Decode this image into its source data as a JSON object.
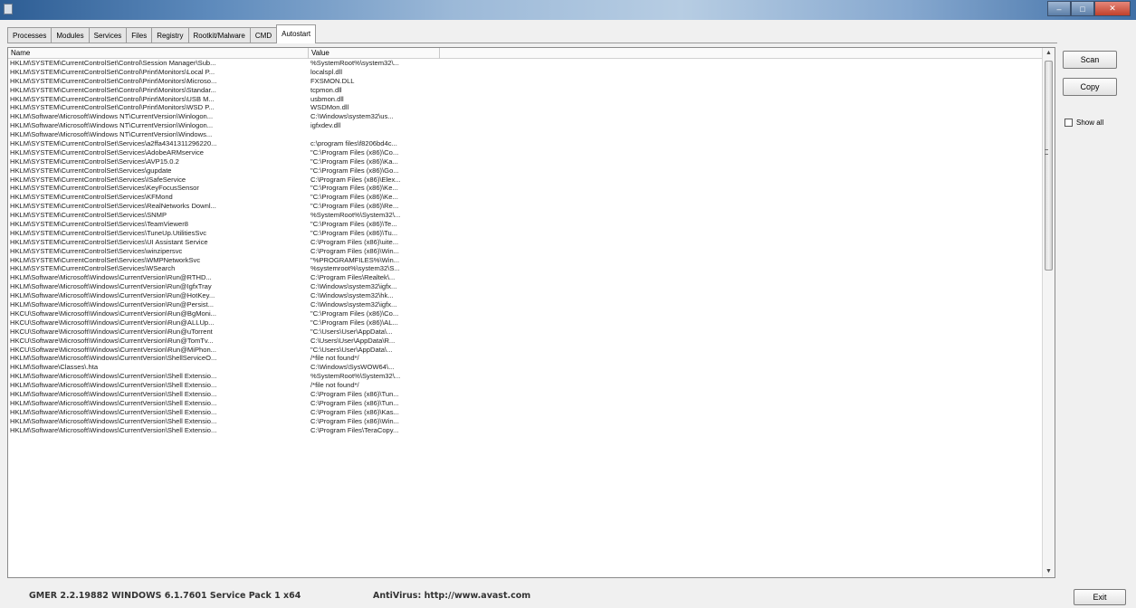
{
  "window": {
    "controls": {
      "minimize": "–",
      "maximize": "□",
      "close": "✕"
    }
  },
  "tabs": [
    "Processes",
    "Modules",
    "Services",
    "Files",
    "Registry",
    "Rootkit/Malware",
    "CMD",
    "Autostart"
  ],
  "active_tab": "Autostart",
  "table": {
    "columns": [
      "Name",
      "Value"
    ],
    "rows": [
      [
        "HKLM\\SYSTEM\\CurrentControlSet\\Control\\Session Manager\\Sub...",
        "%SystemRoot%\\system32\\..."
      ],
      [
        "HKLM\\SYSTEM\\CurrentControlSet\\Control\\Print\\Monitors\\Local P...",
        "localspl.dll"
      ],
      [
        "HKLM\\SYSTEM\\CurrentControlSet\\Control\\Print\\Monitors\\Microso...",
        "FXSMON.DLL"
      ],
      [
        "HKLM\\SYSTEM\\CurrentControlSet\\Control\\Print\\Monitors\\Standar...",
        "tcpmon.dll"
      ],
      [
        "HKLM\\SYSTEM\\CurrentControlSet\\Control\\Print\\Monitors\\USB M...",
        "usbmon.dll"
      ],
      [
        "HKLM\\SYSTEM\\CurrentControlSet\\Control\\Print\\Monitors\\WSD P...",
        "WSDMon.dll"
      ],
      [
        "HKLM\\Software\\Microsoft\\Windows NT\\CurrentVersion\\Winlogon...",
        "C:\\Windows\\system32\\us..."
      ],
      [
        "HKLM\\Software\\Microsoft\\Windows NT\\CurrentVersion\\Winlogon...",
        "igfxdev.dll"
      ],
      [
        "HKLM\\Software\\Microsoft\\Windows NT\\CurrentVersion\\Windows...",
        ""
      ],
      [
        "HKLM\\SYSTEM\\CurrentControlSet\\Services\\a2ffa4341311296220...",
        "c:\\program files\\f8206bd4c..."
      ],
      [
        "HKLM\\SYSTEM\\CurrentControlSet\\Services\\AdobeARMservice",
        "\"C:\\Program Files (x86)\\Co..."
      ],
      [
        "HKLM\\SYSTEM\\CurrentControlSet\\Services\\AVP15.0.2",
        "\"C:\\Program Files (x86)\\Ka..."
      ],
      [
        "HKLM\\SYSTEM\\CurrentControlSet\\Services\\gupdate",
        "\"C:\\Program Files (x86)\\Go..."
      ],
      [
        "HKLM\\SYSTEM\\CurrentControlSet\\Services\\ISafeService",
        "C:\\Program Files (x86)\\Elex..."
      ],
      [
        "HKLM\\SYSTEM\\CurrentControlSet\\Services\\KeyFocusSensor",
        "\"C:\\Program Files (x86)\\Ke..."
      ],
      [
        "HKLM\\SYSTEM\\CurrentControlSet\\Services\\KFMond",
        "\"C:\\Program Files (x86)\\Ke..."
      ],
      [
        "HKLM\\SYSTEM\\CurrentControlSet\\Services\\RealNetworks Downl...",
        "\"C:\\Program Files (x86)\\Re..."
      ],
      [
        "HKLM\\SYSTEM\\CurrentControlSet\\Services\\SNMP",
        "%SystemRoot%\\System32\\..."
      ],
      [
        "HKLM\\SYSTEM\\CurrentControlSet\\Services\\TeamViewer8",
        "\"C:\\Program Files (x86)\\Te..."
      ],
      [
        "HKLM\\SYSTEM\\CurrentControlSet\\Services\\TuneUp.UtilitiesSvc",
        "\"C:\\Program Files (x86)\\Tu..."
      ],
      [
        "HKLM\\SYSTEM\\CurrentControlSet\\Services\\UI Assistant Service",
        "C:\\Program Files (x86)\\uite..."
      ],
      [
        "HKLM\\SYSTEM\\CurrentControlSet\\Services\\winzipersvc",
        "C:\\Program Files (x86)\\Win..."
      ],
      [
        "HKLM\\SYSTEM\\CurrentControlSet\\Services\\WMPNetworkSvc",
        "\"%PROGRAMFILES%\\Win..."
      ],
      [
        "HKLM\\SYSTEM\\CurrentControlSet\\Services\\WSearch",
        "%systemroot%\\system32\\S..."
      ],
      [
        "HKLM\\Software\\Microsoft\\Windows\\CurrentVersion\\Run@RTHD...",
        "C:\\Program Files\\Realtek\\..."
      ],
      [
        "HKLM\\Software\\Microsoft\\Windows\\CurrentVersion\\Run@IgfxTray",
        "C:\\Windows\\system32\\igfx..."
      ],
      [
        "HKLM\\Software\\Microsoft\\Windows\\CurrentVersion\\Run@HotKey...",
        "C:\\Windows\\system32\\hk..."
      ],
      [
        "HKLM\\Software\\Microsoft\\Windows\\CurrentVersion\\Run@Persist...",
        "C:\\Windows\\system32\\igfx..."
      ],
      [
        "HKCU\\Software\\Microsoft\\Windows\\CurrentVersion\\Run@BgMoni...",
        "\"C:\\Program Files (x86)\\Co..."
      ],
      [
        "HKCU\\Software\\Microsoft\\Windows\\CurrentVersion\\Run@ALLUp...",
        "\"C:\\Program Files (x86)\\AL..."
      ],
      [
        "HKCU\\Software\\Microsoft\\Windows\\CurrentVersion\\Run@uTorrent",
        "\"C:\\Users\\User\\AppData\\..."
      ],
      [
        "HKCU\\Software\\Microsoft\\Windows\\CurrentVersion\\Run@TomTv...",
        "C:\\Users\\User\\AppData\\R..."
      ],
      [
        "HKCU\\Software\\Microsoft\\Windows\\CurrentVersion\\Run@MiPhon...",
        "\"C:\\Users\\User\\AppData\\..."
      ],
      [
        "HKLM\\Software\\Microsoft\\Windows\\CurrentVersion\\ShellServiceO...",
        "/*file not found*/"
      ],
      [
        "HKLM\\Software\\Classes\\.hta",
        "C:\\Windows\\SysWOW64\\..."
      ],
      [
        "HKLM\\Software\\Microsoft\\Windows\\CurrentVersion\\Shell Extensio...",
        "%SystemRoot%\\System32\\..."
      ],
      [
        "HKLM\\Software\\Microsoft\\Windows\\CurrentVersion\\Shell Extensio...",
        "/*file not found*/"
      ],
      [
        "HKLM\\Software\\Microsoft\\Windows\\CurrentVersion\\Shell Extensio...",
        "C:\\Program Files (x86)\\Tun..."
      ],
      [
        "HKLM\\Software\\Microsoft\\Windows\\CurrentVersion\\Shell Extensio...",
        "C:\\Program Files (x86)\\Tun..."
      ],
      [
        "HKLM\\Software\\Microsoft\\Windows\\CurrentVersion\\Shell Extensio...",
        "C:\\Program Files (x86)\\Kas..."
      ],
      [
        "HKLM\\Software\\Microsoft\\Windows\\CurrentVersion\\Shell Extensio...",
        "C:\\Program Files (x86)\\Win..."
      ],
      [
        "HKLM\\Software\\Microsoft\\Windows\\CurrentVersion\\Shell Extensio...",
        "C:\\Program Files\\TeraCopy..."
      ]
    ]
  },
  "buttons": {
    "scan": "Scan",
    "copy": "Copy",
    "exit": "Exit"
  },
  "show_all": {
    "label": "Show all",
    "checked": false
  },
  "status": {
    "version": "GMER 2.2.19882     WINDOWS 6.1.7601 Service Pack 1 x64",
    "antivirus": "AntiVirus: http://www.avast.com"
  },
  "icons": {
    "checkbox": "checkbox-unchecked",
    "scroll_up": "chevron-up-icon",
    "scroll_down": "chevron-down-icon"
  }
}
